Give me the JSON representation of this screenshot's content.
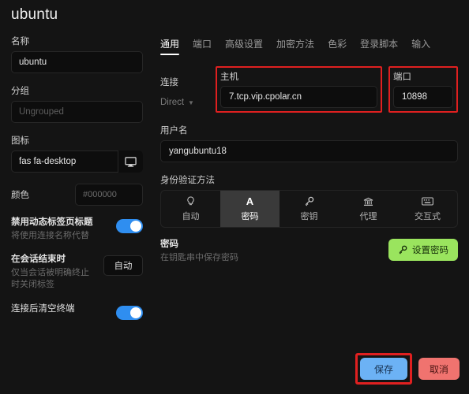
{
  "window": {
    "title": "ubuntu"
  },
  "left_panel": {
    "name": {
      "label": "名称",
      "value": "ubuntu"
    },
    "group": {
      "label": "分组",
      "placeholder": "Ungrouped",
      "value": ""
    },
    "icon": {
      "label": "图标",
      "value": "fas fa-desktop",
      "button_icon": "monitor-icon"
    },
    "color": {
      "label": "颜色",
      "value": "#000000"
    },
    "disable_dynamic_tab_title": {
      "title": "禁用动态标签页标题",
      "subtitle": "将使用连接名称代替",
      "enabled": true
    },
    "on_session_end": {
      "title": "在会话结束时",
      "subtitle": "仅当会话被明确终止时关闭标签",
      "value": "自动"
    },
    "clear_terminal_after_connect": {
      "title": "连接后清空终端",
      "subtitle": "",
      "enabled": true
    }
  },
  "right_panel": {
    "tabs": [
      {
        "label": "通用",
        "active": true
      },
      {
        "label": "端口",
        "active": false
      },
      {
        "label": "高级设置",
        "active": false
      },
      {
        "label": "加密方法",
        "active": false
      },
      {
        "label": "色彩",
        "active": false
      },
      {
        "label": "登录脚本",
        "active": false
      },
      {
        "label": "输入",
        "active": false
      }
    ],
    "connection": {
      "label": "连接",
      "value": "Direct"
    },
    "host": {
      "label": "主机",
      "value": "7.tcp.vip.cpolar.cn",
      "highlighted": true
    },
    "port": {
      "label": "端口",
      "value": "10898",
      "highlighted": true
    },
    "username": {
      "label": "用户名",
      "value": "yangubuntu18"
    },
    "auth": {
      "label": "身份验证方法",
      "options": [
        {
          "label": "自动",
          "icon": "lightbulb-icon",
          "glyph": "♀",
          "active": false
        },
        {
          "label": "密码",
          "icon": "letter-a-icon",
          "glyph": "A",
          "active": true
        },
        {
          "label": "密钥",
          "icon": "key-icon",
          "glyph": "⚷",
          "active": false
        },
        {
          "label": "代理",
          "icon": "bank-icon",
          "glyph": "🏛",
          "active": false
        },
        {
          "label": "交互式",
          "icon": "keyboard-icon",
          "glyph": "⌨",
          "active": false
        }
      ]
    },
    "password": {
      "title": "密码",
      "subtitle": "在钥匙串中保存密码",
      "button_label": "设置密码",
      "button_icon": "key-icon"
    }
  },
  "footer": {
    "save": {
      "label": "保存",
      "highlighted": true
    },
    "cancel": {
      "label": "取消"
    }
  },
  "colors": {
    "accent_blue": "#2f8ef0",
    "save_blue": "#6cb2f5",
    "cancel_red": "#f0736f",
    "green": "#9ae45e",
    "highlight_red": "#e02020",
    "background": "#141414"
  }
}
